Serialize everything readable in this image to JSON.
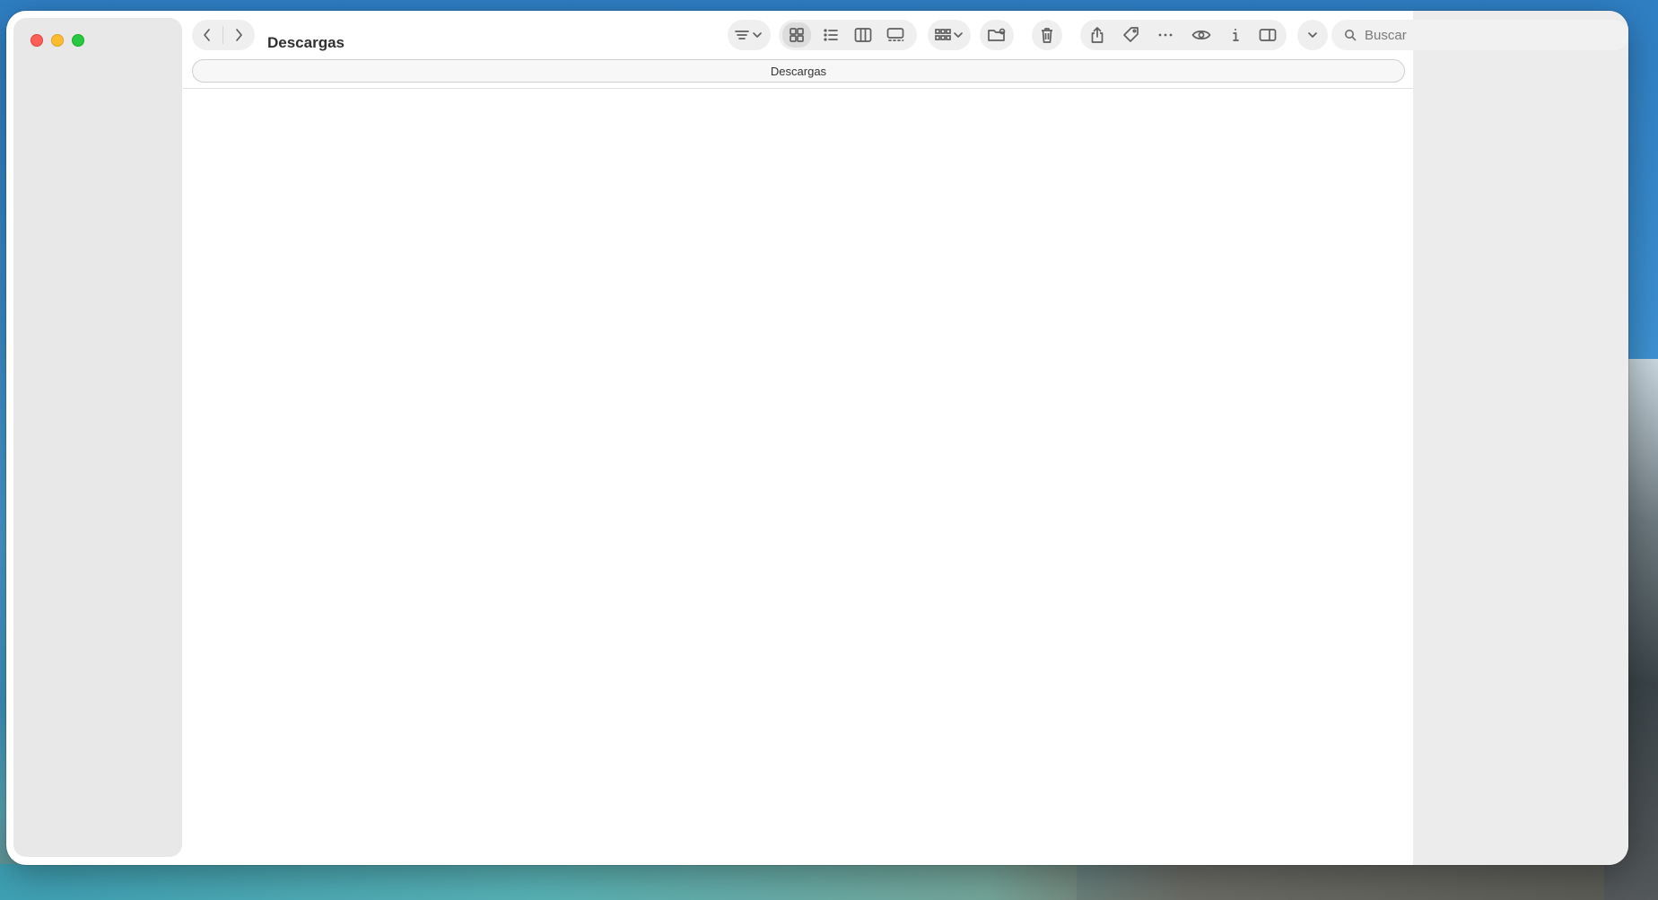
{
  "window": {
    "title": "Descargas",
    "path_segment": "Descargas"
  },
  "toolbar": {
    "back_icon": "chevron-left-icon",
    "forward_icon": "chevron-right-icon",
    "sort_icon": "list-sort-icon",
    "views": [
      "icon-view",
      "list-view",
      "column-view",
      "gallery-view"
    ],
    "active_view": "icon-view",
    "group_icon": "group-grid-icon",
    "new_folder_icon": "new-folder-icon",
    "trash_icon": "trash-icon",
    "share_icon": "share-icon",
    "tag_icon": "tag-icon",
    "more_icon": "ellipsis-icon",
    "preview_icon": "eye-icon",
    "info_icon": "info-icon",
    "sidebar_toggle_icon": "sidebar-right-icon",
    "expand_icon": "chevron-down-icon"
  },
  "search": {
    "placeholder": "Buscar"
  },
  "colors": {
    "close": "#fe5f57",
    "minimize": "#febc2e",
    "maximize": "#28c840"
  }
}
